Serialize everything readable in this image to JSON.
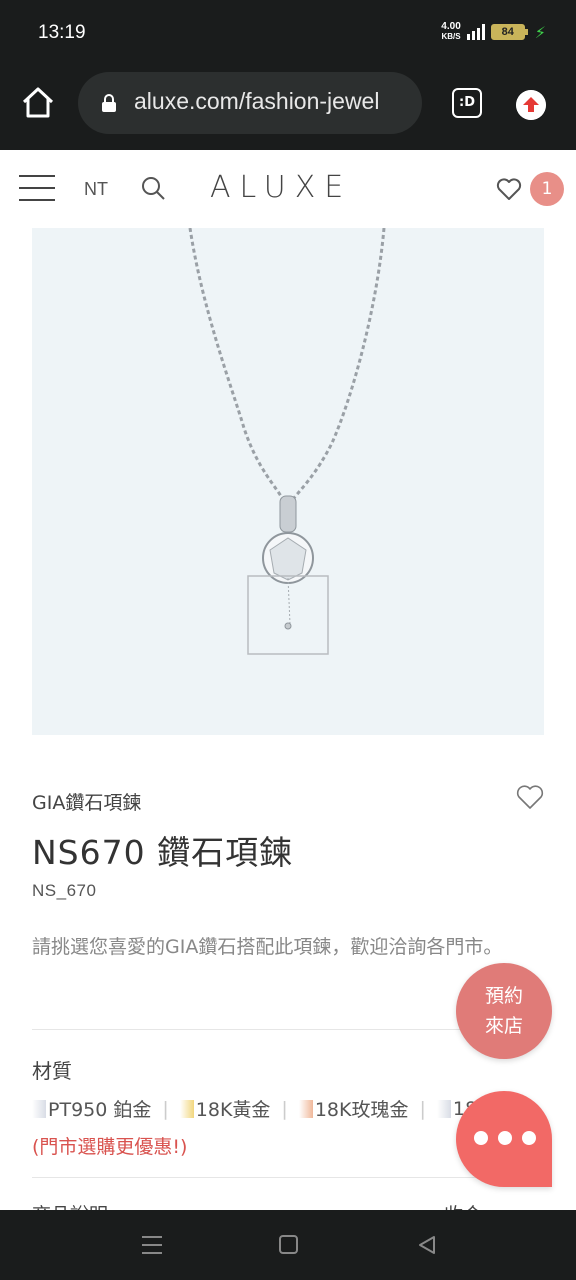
{
  "status_bar": {
    "time": "13:19",
    "net_speed_value": "4.00",
    "net_speed_unit": "KB/S",
    "battery": "84"
  },
  "browser": {
    "url": "aluxe.com/fashion-jewel",
    "tab_switcher_label": ":D"
  },
  "header": {
    "currency": "NT",
    "logo": "ALUXE",
    "cart_count": "1"
  },
  "product": {
    "category": "GIA鑽石項鍊",
    "title": "NS670 鑽石項鍊",
    "sku": "NS_670",
    "description": "請挑選您喜愛的GIA鑽石搭配此項鍊，歡迎洽詢各門市。",
    "material_label": "材質",
    "materials": [
      {
        "label": "PT950 鉑金",
        "color": "#d9dde6"
      },
      {
        "label": "18K黃金",
        "color": "#f2d77e"
      },
      {
        "label": "18K玫瑰金",
        "color": "#f0b89a"
      },
      {
        "label": "18",
        "color": "#d9dde6"
      }
    ],
    "store_promo": "(門市選購更優惠!)",
    "next_section_label": "商品說明",
    "next_section_right": "收合"
  },
  "floating": {
    "book_line1": "預約",
    "book_line2": "來店"
  },
  "colors": {
    "accent": "#e07b78",
    "chat": "#f26966",
    "promo": "#d9534f"
  }
}
